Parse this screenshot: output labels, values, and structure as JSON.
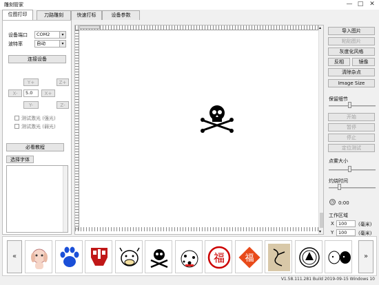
{
  "window": {
    "title": "雕刻管家",
    "min": "—",
    "max": "□",
    "close": "✕"
  },
  "tabs": [
    {
      "label": "位图打印"
    },
    {
      "label": "刀路雕刻"
    },
    {
      "label": "快速打标"
    },
    {
      "label": "设备参数"
    }
  ],
  "left": {
    "port_label": "设备端口",
    "port_value": "COM2",
    "baud_label": "波特率",
    "baud_value": "自动",
    "connect": "连接设备",
    "jog": {
      "yplus": "Y+",
      "zplus": "Z+",
      "xminus": "X-",
      "step": "5.0",
      "xplus": "X+",
      "yminus": "Y-",
      "zminus": "Z-"
    },
    "test_laser_strong": "测试激光 (强光)",
    "test_laser_weak": "测试激光 (弱光)",
    "tutorial": "必看教程",
    "choose_font": "选择字体"
  },
  "right": {
    "import_image": "导入图片",
    "paste_image": "粘贴图片",
    "grayscale": "灰度化风格",
    "invert": "反相",
    "mirror": "镜像",
    "clean": "清除杂点",
    "image_size": "Image Size",
    "detail_label": "保留细节",
    "start": "开始",
    "pause": "暂停",
    "stop": "停止",
    "position_test": "定位测试",
    "dot_size_label": "点雾大小",
    "burn_time_label": "灼烧时间",
    "time": "0:00",
    "work_area_label": "工作区域",
    "x_label": "X",
    "x_value": "100",
    "x_unit": "(毫米)",
    "y_label": "Y",
    "y_value": "100",
    "y_unit": "(毫米)"
  },
  "sliders": {
    "detail": 0.45,
    "dot_size": 0.45,
    "burn_time": 0.2
  },
  "gallery": {
    "prev": "«",
    "next": "»",
    "items": [
      {
        "name": "puppy-icon"
      },
      {
        "name": "paw-icon"
      },
      {
        "name": "transformers-logo-icon"
      },
      {
        "name": "cow-icon"
      },
      {
        "name": "skull-crossbones-icon"
      },
      {
        "name": "dalmatian-icon"
      },
      {
        "name": "fu-circle-icon",
        "text": "福"
      },
      {
        "name": "fu-diamond-icon",
        "text": "福"
      },
      {
        "name": "dragon-icon"
      },
      {
        "name": "emblem-icon"
      },
      {
        "name": "sheep-icon"
      }
    ]
  },
  "status": "V1.58.111.281 Build 2019-09-15 Windows 10"
}
